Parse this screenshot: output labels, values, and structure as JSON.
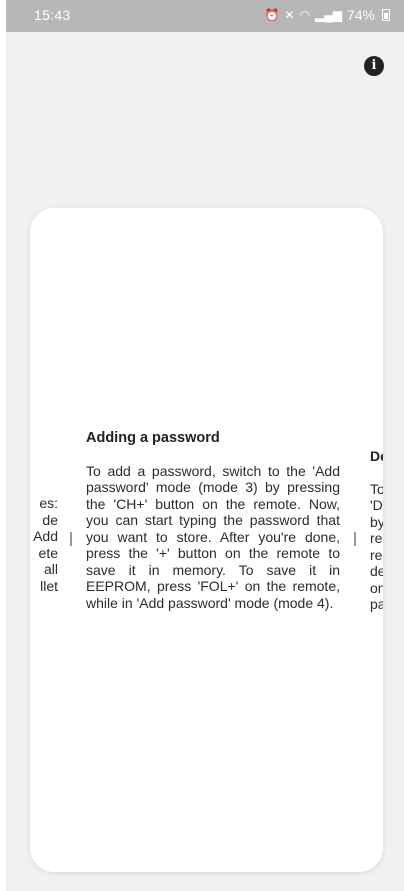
{
  "status_bar": {
    "time": "15:43",
    "battery": "74%",
    "icons": [
      "alarm-icon",
      "mute-icon",
      "wifi-icon",
      "signal-icon",
      "battery-icon"
    ]
  },
  "info_button": {
    "icon": "info-icon",
    "glyph": "i"
  },
  "previous_slide": {
    "text": "es:\nde\nAdd\nete\nall\nllet"
  },
  "current_slide": {
    "title": "Adding a password",
    "body": "To add a password, switch to the 'Add password' mode (mode 3) by pressing the 'CH+' button on the remote. Now, you can start typing the password that you want to store. After you're done, press the '+' button on the remote to save it in memory. To save it in EEPROM, press 'FOL+' on the remote, while in 'Add password' mode (mode 4)."
  },
  "next_slide": {
    "title": "Del",
    "text": "To\n'De\nby\nren\nren\ndel\non\npas"
  }
}
